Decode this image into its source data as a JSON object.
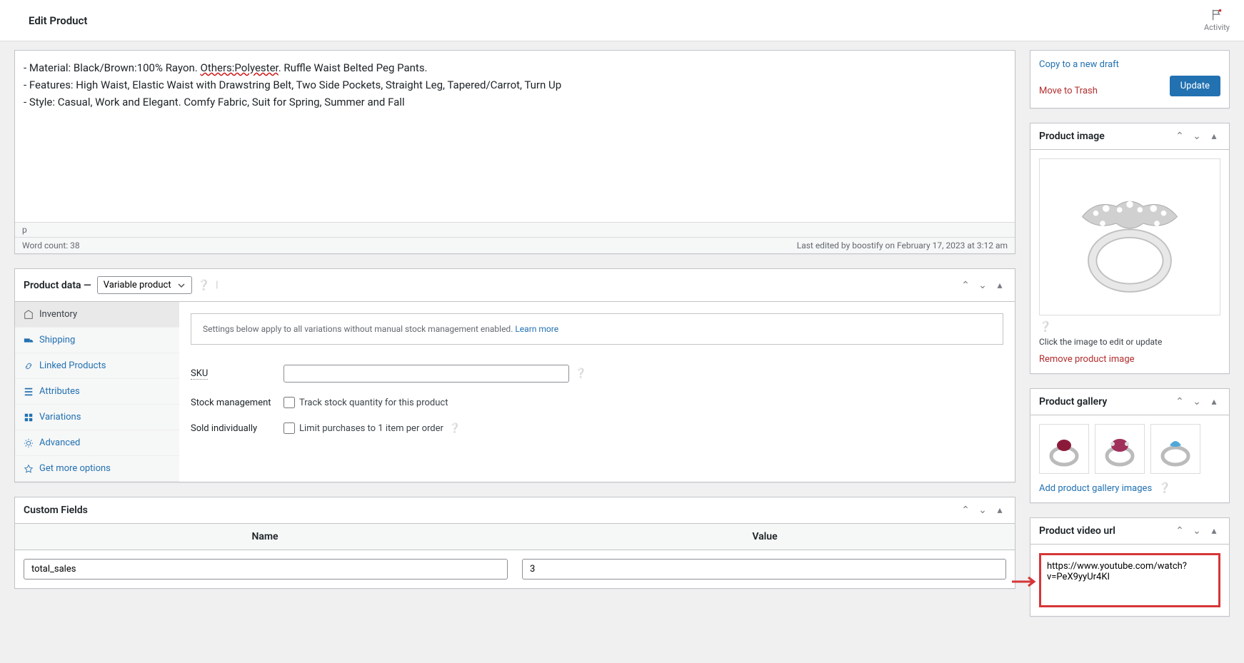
{
  "header": {
    "title": "Edit Product",
    "activity": "Activity"
  },
  "editor": {
    "line1a": "- Material: Black/Brown:100% Rayon. ",
    "line1b": "Others:Polyester",
    "line1c": ". Ruffle Waist Belted Peg Pants.",
    "line2": "- Features: High Waist, Elastic Waist with Drawstring Belt, Two Side Pockets, Straight Leg, Tapered/Carrot, Turn Up",
    "line3": "- Style: Casual, Work and Elegant. Comfy Fabric, Suit for Spring, Summer and Fall",
    "path": "p",
    "wordcount": "Word count: 38",
    "lastedit": "Last edited by boostify on February 17, 2023 at 3:12 am"
  },
  "productData": {
    "title": "Product data —",
    "type": "Variable product",
    "tabs": {
      "inventory": "Inventory",
      "shipping": "Shipping",
      "linked": "Linked Products",
      "attributes": "Attributes",
      "variations": "Variations",
      "advanced": "Advanced",
      "more": "Get more options"
    },
    "notice": "Settings below apply to all variations without manual stock management enabled. ",
    "noticeLink": "Learn more",
    "sku": "SKU",
    "stockMgmt": "Stock management",
    "stockCb": "Track stock quantity for this product",
    "soldInd": "Sold individually",
    "soldCb": "Limit purchases to 1 item per order"
  },
  "customFields": {
    "title": "Custom Fields",
    "nameHdr": "Name",
    "valueHdr": "Value",
    "row1name": "total_sales",
    "row1value": "3"
  },
  "publish": {
    "copy": "Copy to a new draft",
    "trash": "Move to Trash",
    "update": "Update"
  },
  "productImage": {
    "title": "Product image",
    "hint": "Click the image to edit or update",
    "remove": "Remove product image"
  },
  "gallery": {
    "title": "Product gallery",
    "add": "Add product gallery images"
  },
  "video": {
    "title": "Product video url",
    "value": "https://www.youtube.com/watch?v=PeX9yyUr4KI"
  }
}
